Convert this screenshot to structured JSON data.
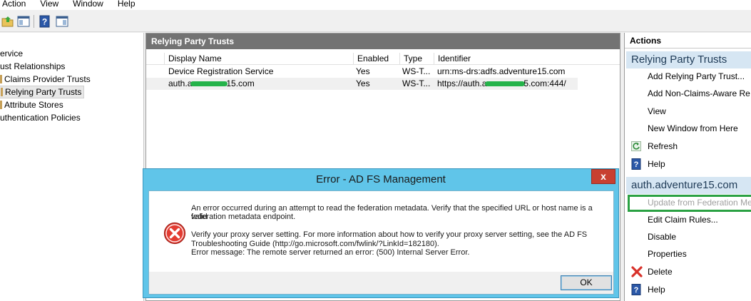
{
  "menu": [
    "Action",
    "View",
    "Window",
    "Help"
  ],
  "toolbar": {
    "icons": [
      "up-folder-icon",
      "show-hide-console-tree-icon",
      "help-icon",
      "show-hide-action-pane-icon"
    ]
  },
  "tree": {
    "items": [
      {
        "label": "ervice"
      },
      {
        "label": "ust Relationships"
      },
      {
        "label": "Claims Provider Trusts"
      },
      {
        "label": "Relying Party Trusts"
      },
      {
        "label": "Attribute Stores"
      },
      {
        "label": "uthentication Policies"
      }
    ]
  },
  "center": {
    "title": "Relying Party Trusts",
    "columns": [
      "Display Name",
      "Enabled",
      "Type",
      "Identifier"
    ],
    "rows": [
      {
        "name": "Device Registration Service",
        "enabled": "Yes",
        "type": "WS-T...",
        "identifier": "urn:ms-drs:adfs.adventure15.com"
      },
      {
        "name_pre": "auth.a",
        "name_post": "15.com",
        "enabled": "Yes",
        "type": "WS-T...",
        "id_pre": "https://auth.a",
        "id_post": "5.com:444/"
      }
    ]
  },
  "actions": {
    "title": "Actions",
    "section1": "Relying Party Trusts",
    "section1_items": [
      "Add Relying Party Trust...",
      "Add Non-Claims-Aware Re",
      "View",
      "New Window from Here",
      "Refresh",
      "Help"
    ],
    "section2": "auth.adventure15.com",
    "section2_items": [
      "Update from Federation Me",
      "Edit Claim Rules...",
      "Disable",
      "Properties",
      "Delete",
      "Help"
    ]
  },
  "dialog": {
    "title": "Error - AD FS Management",
    "close": "x",
    "line1": "An error occurred during an attempt to read the federation metadata.  Verify that the specified URL or host name is a valid",
    "line2": "federation metadata endpoint.",
    "line3": "Verify your proxy server setting. For more information about how to verify your proxy server setting, see the AD FS",
    "line4": "Troubleshooting Guide (http://go.microsoft.com/fwlink/?LinkId=182180).",
    "line5": "Error message: The remote server returned an error: (500) Internal Server Error.",
    "ok": "OK"
  },
  "colors": {
    "dialog_frame": "#60c5e9",
    "close_button": "#c84031",
    "section_header": "#d6e6f3",
    "highlight_box": "#2aa143",
    "redaction": "#25b34a"
  }
}
